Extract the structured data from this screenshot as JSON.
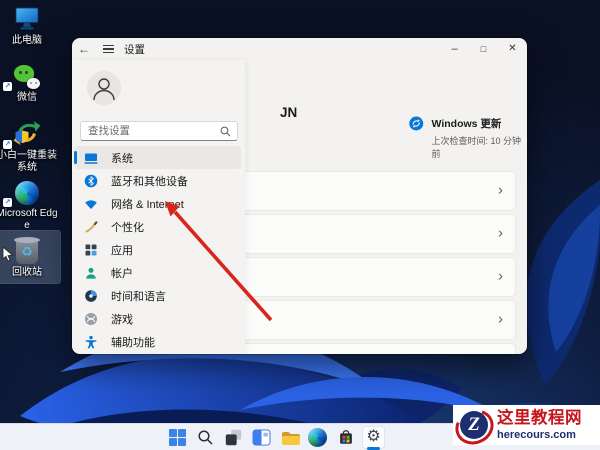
{
  "colors": {
    "accent": "#0a77d6",
    "arrow": "#d9261c",
    "watermark_red": "#c4161c",
    "watermark_navy": "#1d2f6e"
  },
  "icons": {
    "back": "←",
    "minimize": "–",
    "maximize": "□",
    "close": "✕",
    "chevron_right": "›",
    "gear": "⚙",
    "recycle": "♻",
    "shortcut_arrow": "↗"
  },
  "desktop": {
    "icons": [
      {
        "label": "此电脑"
      },
      {
        "label": "微信"
      },
      {
        "label": "小白一键重装系统"
      },
      {
        "label": "Microsoft Edge"
      },
      {
        "label": "回收站"
      }
    ]
  },
  "settings_window": {
    "title": "设置",
    "search": {
      "placeholder": "查找设置"
    },
    "visible_text_fragment": "JN",
    "windows_update": {
      "title": "Windows 更新",
      "status": "上次检查时间: 10 分钟前"
    },
    "nav": [
      {
        "label": "系统",
        "selected": true
      },
      {
        "label": "蓝牙和其他设备",
        "selected": false
      },
      {
        "label": "网络 & Internet",
        "selected": false
      },
      {
        "label": "个性化",
        "selected": false
      },
      {
        "label": "应用",
        "selected": false
      },
      {
        "label": "帐户",
        "selected": false
      },
      {
        "label": "时间和语言",
        "selected": false
      },
      {
        "label": "游戏",
        "selected": false
      },
      {
        "label": "辅助功能",
        "selected": false
      }
    ]
  },
  "annotation_arrow": {
    "points_to": "网络 & Internet"
  },
  "taskbar": {
    "buttons": [
      "start",
      "search",
      "task-view",
      "widgets",
      "file-explorer",
      "edge",
      "microsoft-store",
      "settings"
    ],
    "active_button": "settings"
  },
  "watermark": {
    "site_name": "这里教程网",
    "site_url": "herecours.com",
    "logo_letter": "Z"
  }
}
